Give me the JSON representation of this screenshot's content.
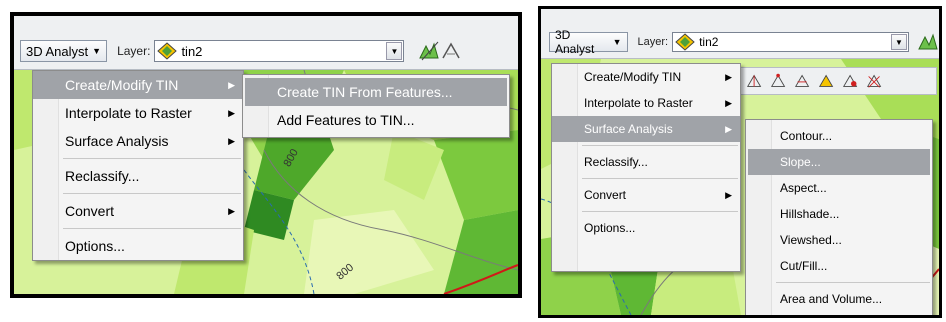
{
  "left": {
    "toolbar": {
      "analyst_label": "3D Analyst",
      "layer_label": "Layer:",
      "layer_value": "tin2"
    },
    "main_menu": [
      {
        "label": "Create/Modify TIN",
        "submenu": true,
        "highlighted": true
      },
      {
        "label": "Interpolate to Raster",
        "submenu": true,
        "highlighted": false
      },
      {
        "label": "Surface Analysis",
        "submenu": true,
        "highlighted": false
      },
      {
        "label": "Reclassify...",
        "submenu": false,
        "highlighted": false
      },
      {
        "label": "Convert",
        "submenu": true,
        "highlighted": false
      },
      {
        "label": "Options...",
        "submenu": false,
        "highlighted": false
      }
    ],
    "sub_menu": [
      {
        "label": "Create TIN From Features...",
        "highlighted": true
      },
      {
        "label": "Add Features to TIN...",
        "highlighted": false
      }
    ],
    "map_labels": [
      "800",
      "800"
    ]
  },
  "right": {
    "toolbar": {
      "analyst_label": "3D Analyst",
      "layer_label": "Layer:",
      "layer_value": "tin2"
    },
    "main_menu": [
      {
        "label": "Create/Modify TIN",
        "submenu": true,
        "highlighted": false
      },
      {
        "label": "Interpolate to Raster",
        "submenu": true,
        "highlighted": false
      },
      {
        "label": "Surface Analysis",
        "submenu": true,
        "highlighted": true
      },
      {
        "label": "Reclassify...",
        "submenu": false,
        "highlighted": false
      },
      {
        "label": "Convert",
        "submenu": true,
        "highlighted": false
      },
      {
        "label": "Options...",
        "submenu": false,
        "highlighted": false
      }
    ],
    "sub_menu": [
      {
        "label": "Contour...",
        "highlighted": false
      },
      {
        "label": "Slope...",
        "highlighted": true
      },
      {
        "label": "Aspect...",
        "highlighted": false
      },
      {
        "label": "Hillshade...",
        "highlighted": false
      },
      {
        "label": "Viewshed...",
        "highlighted": false
      },
      {
        "label": "Cut/Fill...",
        "highlighted": false
      },
      {
        "label": "Area and Volume...",
        "highlighted": false
      }
    ]
  },
  "colors": {
    "menu_highlight": "#a0a3a8",
    "terrain_light": "#d7f29a",
    "terrain_mid": "#9bd84a",
    "terrain_dark": "#3f9a2a",
    "contour_red": "#d01818"
  },
  "icons": [
    "dropdown-arrow-icon",
    "tin-layer-icon",
    "submenu-arrow-icon",
    "tin-edit-tool-icon"
  ]
}
